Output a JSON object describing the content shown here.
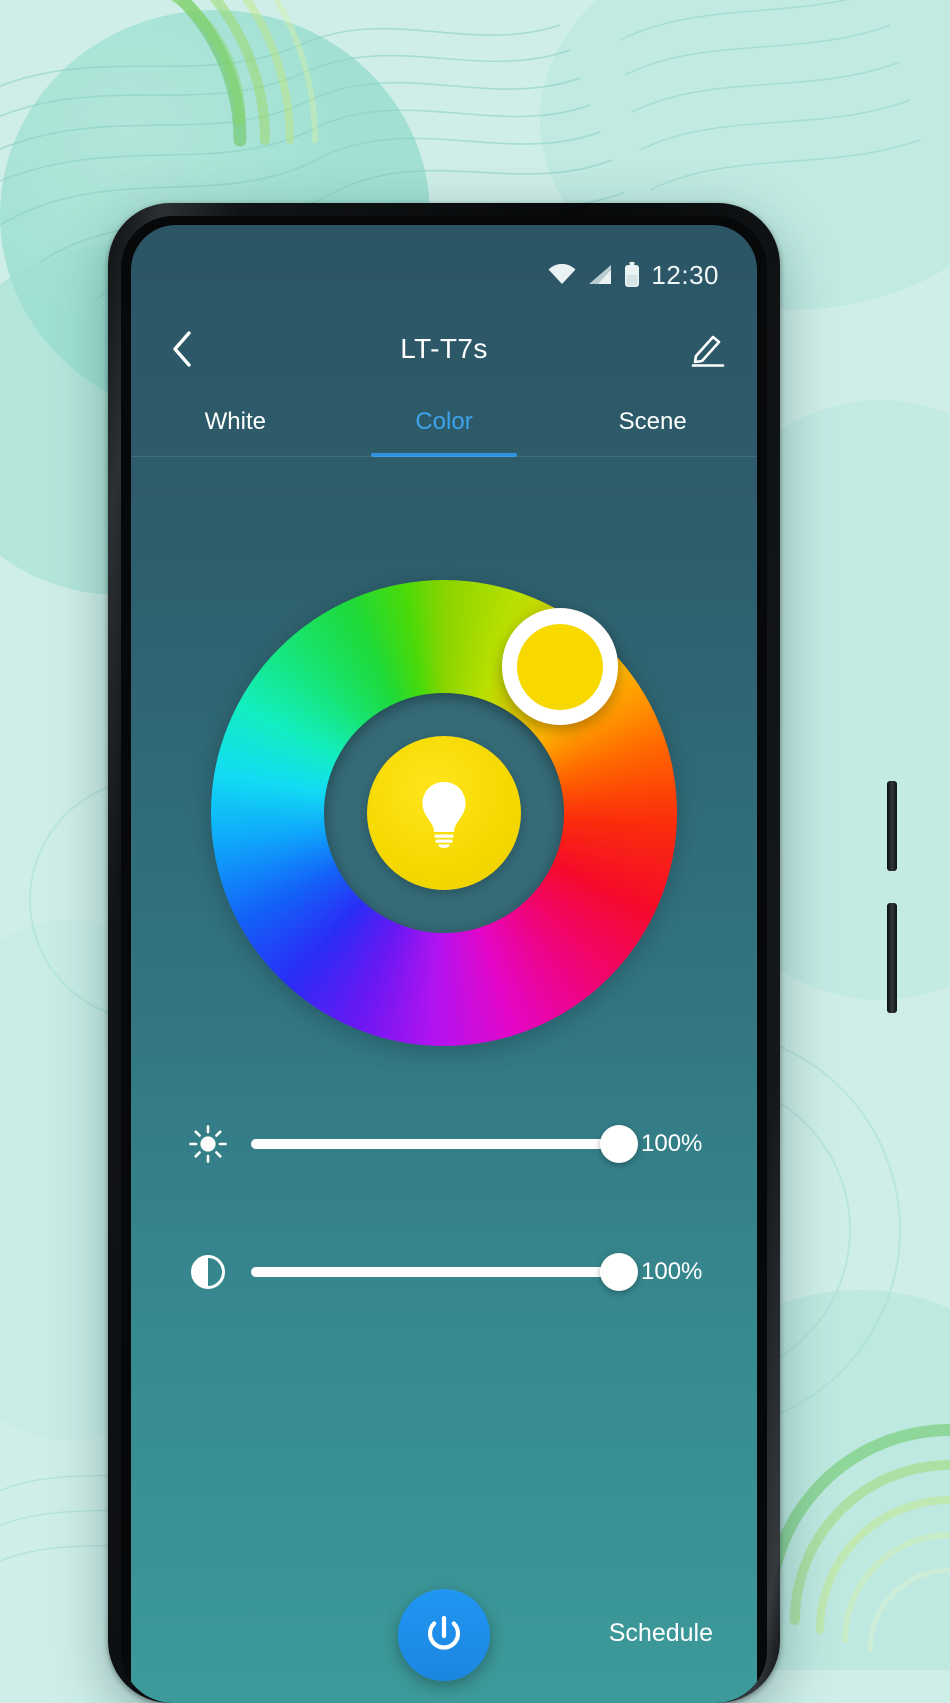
{
  "background": {
    "base_color": "#cfeee8",
    "accent_color": "#7fd4c4"
  },
  "status_bar": {
    "time": "12:30",
    "icons": [
      "wifi-icon",
      "cellular-signal-icon",
      "battery-icon"
    ]
  },
  "app_bar": {
    "back_icon": "back-chevron-icon",
    "title": "LT-T7s",
    "edit_icon": "pencil-edit-icon"
  },
  "tabs": {
    "active_index": 1,
    "active_color": "#3ea3ea",
    "items": [
      {
        "label": "White"
      },
      {
        "label": "Color"
      },
      {
        "label": "Scene"
      }
    ]
  },
  "color_wheel": {
    "selected_color": "#f7d900",
    "center_color": "#f5d800",
    "center_icon": "light-bulb-icon",
    "thumb_icon": "color-selector-thumb",
    "hole_color": "#356a77"
  },
  "sliders": [
    {
      "name": "brightness",
      "icon": "brightness-sun-icon",
      "value": 100,
      "value_label": "100%"
    },
    {
      "name": "saturation",
      "icon": "contrast-half-circle-icon",
      "value": 100,
      "value_label": "100%"
    }
  ],
  "bottom_bar": {
    "power_icon": "power-button-icon",
    "power_color": "#2196f3",
    "schedule_label": "Schedule"
  }
}
